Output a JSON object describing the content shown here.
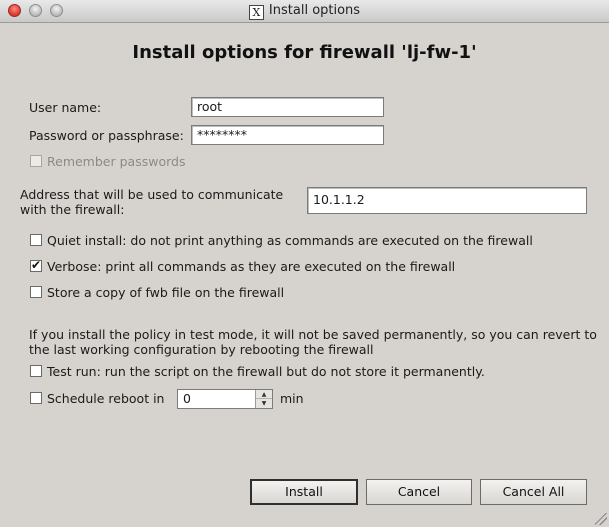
{
  "window": {
    "title": "Install options",
    "title_icon": "x11-icon"
  },
  "heading": "Install options for firewall 'lj-fw-1'",
  "fields": {
    "user_name_label": "User name:",
    "user_name_value": "root",
    "password_label": "Password or passphrase:",
    "password_value": "********",
    "remember_label": "Remember passwords",
    "remember_checked": false,
    "remember_disabled": true,
    "address_label_line1": "Address that will be used to communicate",
    "address_label_line2": "with the firewall:",
    "address_value": "10.1.1.2"
  },
  "options": [
    {
      "label": "Quiet install: do not print anything as commands are executed on the firewall",
      "checked": false
    },
    {
      "label": "Verbose: print all commands as they are executed on the firewall",
      "checked": true
    },
    {
      "label": "Store a copy of fwb file on the firewall",
      "checked": false
    }
  ],
  "test_mode": {
    "info_line1": "If you install the policy in test mode, it will not be saved permanently, so you can revert to",
    "info_line2": "the last working configuration by rebooting the firewall",
    "test_run_label": "Test run: run the script on the firewall but do not store it permanently.",
    "test_run_checked": false,
    "schedule_label": "Schedule reboot in",
    "schedule_checked": false,
    "schedule_value": "0",
    "schedule_unit": "min"
  },
  "buttons": {
    "install": "Install",
    "cancel": "Cancel",
    "cancel_all": "Cancel All"
  }
}
